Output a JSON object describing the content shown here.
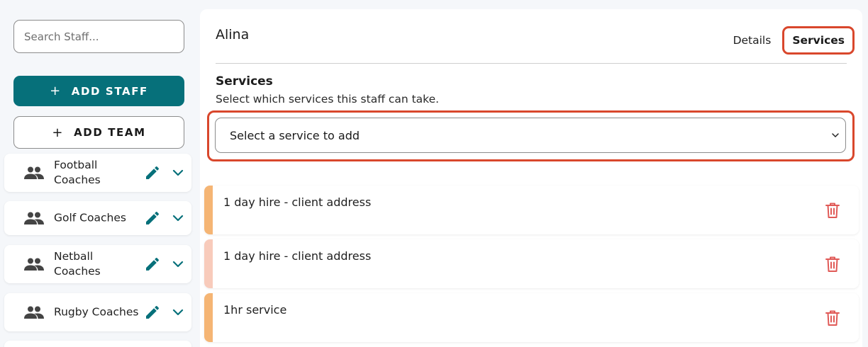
{
  "colors": {
    "primary": "#06707a",
    "highlight": "#d9472c",
    "delete": "#e05a57",
    "stripe_orange": "#f5b574",
    "stripe_peach": "#f8cbbb"
  },
  "sidebar": {
    "search_placeholder": "Search Staff...",
    "add_staff_label": "ADD STAFF",
    "add_team_label": "ADD TEAM",
    "plus_glyph": "+",
    "teams": [
      {
        "name": "Football Coaches",
        "icon": "people-icon"
      },
      {
        "name": "Golf Coaches",
        "icon": "people-icon"
      },
      {
        "name": "Netball Coaches",
        "icon": "people-icon"
      },
      {
        "name": "Rugby Coaches",
        "icon": "people-icon"
      }
    ]
  },
  "main": {
    "staff_name": "Alina",
    "tabs": [
      {
        "label": "Details",
        "active": false
      },
      {
        "label": "Services",
        "active": true
      }
    ],
    "section_title": "Services",
    "section_description": "Select which services this staff can take.",
    "select": {
      "placeholder": "Select a service to add"
    },
    "services": [
      {
        "name": "1 day hire - client address",
        "stripe": "#f5b574"
      },
      {
        "name": "1 day hire - client address",
        "stripe": "#f8cbbb"
      },
      {
        "name": "1hr service",
        "stripe": "#f5b574"
      }
    ]
  }
}
